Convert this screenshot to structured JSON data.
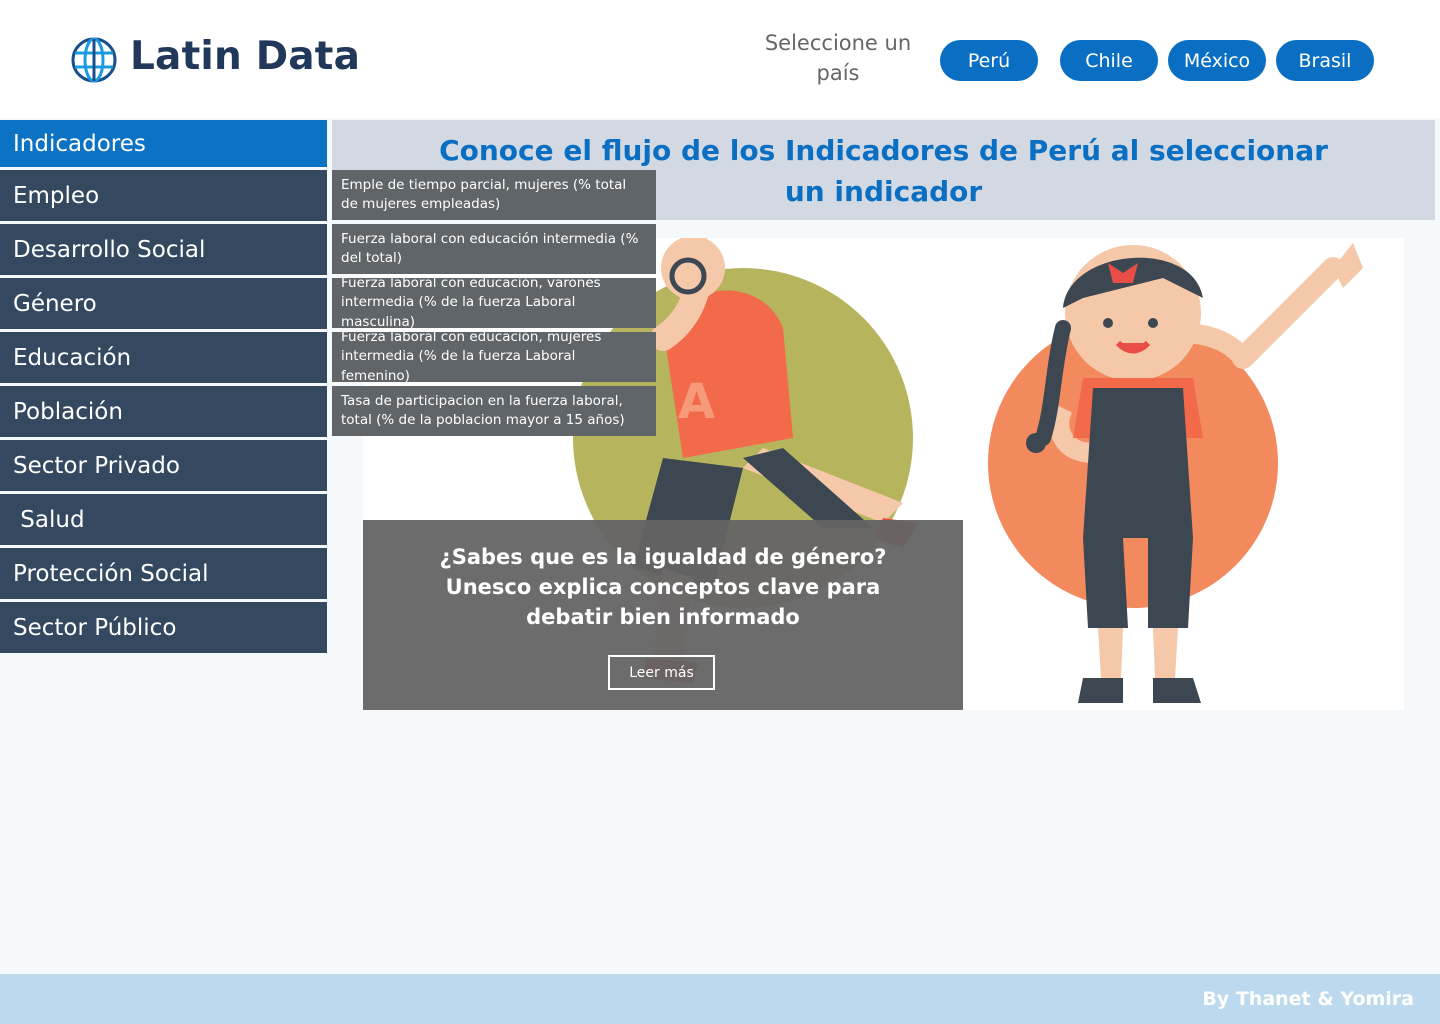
{
  "header": {
    "app_title": "Latin Data",
    "logo_icon": "globe-icon",
    "select_label": "Seleccione un país",
    "countries": [
      "Perú",
      "Chile",
      "México",
      "Brasil"
    ]
  },
  "sidebar": {
    "items": [
      {
        "label": "Indicadores"
      },
      {
        "label": "Empleo"
      },
      {
        "label": "Desarrollo Social"
      },
      {
        "label": "Género"
      },
      {
        "label": "Educación"
      },
      {
        "label": "Población"
      },
      {
        "label": "Sector Privado"
      },
      {
        "label": " Salud"
      },
      {
        "label": "Protección Social"
      },
      {
        "label": "Sector Público"
      }
    ]
  },
  "banner": {
    "title": "Conoce el flujo de los Indicadores de Perú al seleccionar un indicador"
  },
  "dropdown": {
    "items": [
      "Emple de tiempo parcial, mujeres (% total de mujeres empleadas)",
      "Fuerza laboral con educación intermedia (% del total)",
      "Fuerza laboral con educación, varones intermedia (% de la fuerza Laboral masculina)",
      "Fuerza laboral con educación, mujeres intermedia (% de la fuerza Laboral femenino)",
      "Tasa de participacion en la fuerza laboral, total (% de la poblacion mayor a 15 años)"
    ]
  },
  "feature": {
    "headline": "¿Sabes que es la igualdad de género? Unesco explica conceptos clave para debatir bien informado",
    "button_label": "Leer más"
  },
  "footer": {
    "credit": "By Thanet & Yomira"
  },
  "colors": {
    "brand_blue": "#0a6fc2",
    "sidebar_bg": "#344860",
    "dropdown_bg": "#606569",
    "footer_bg": "#bcd9ee"
  }
}
